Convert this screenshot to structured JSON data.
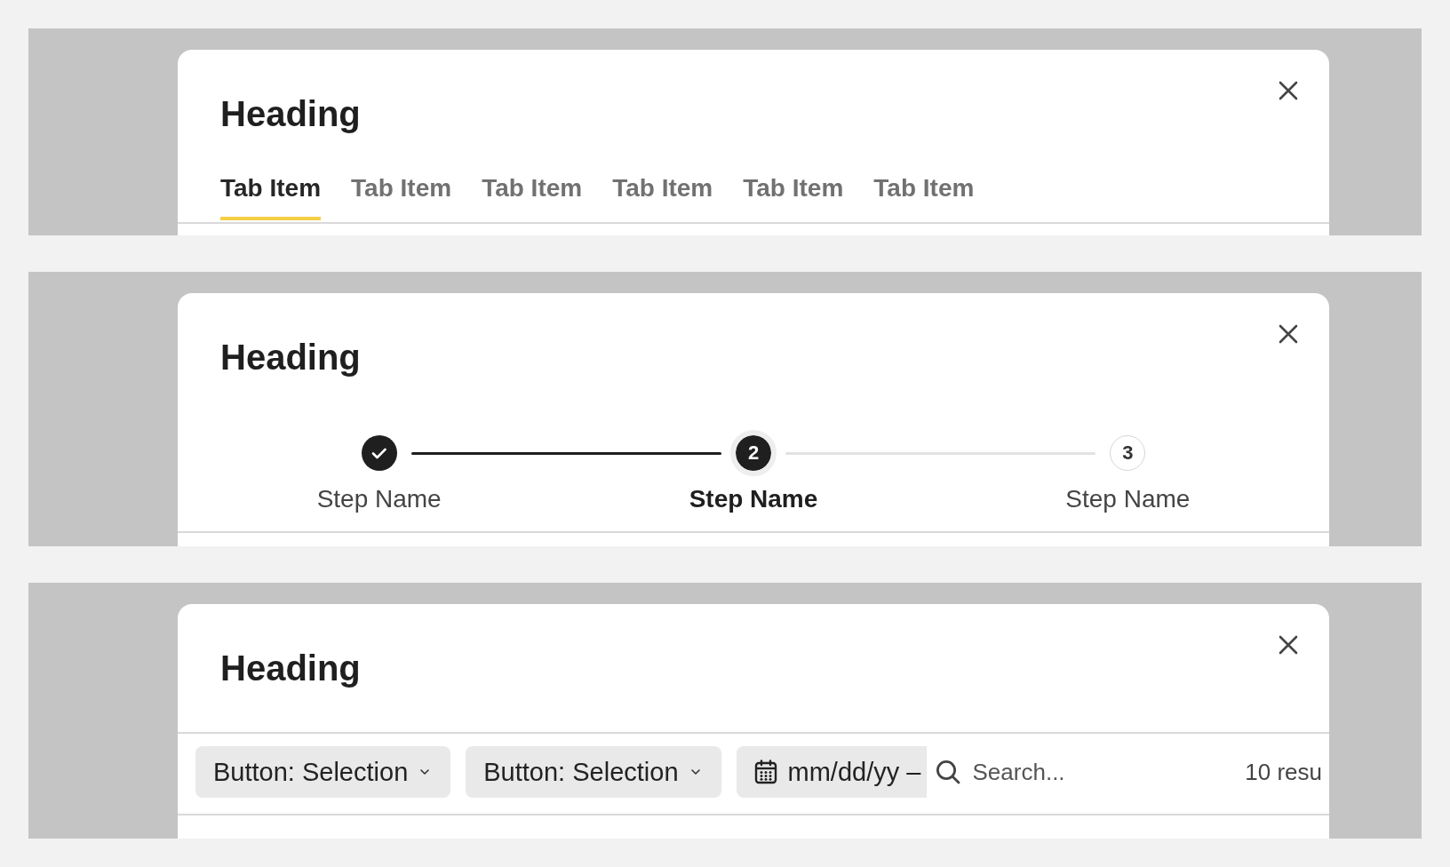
{
  "modals": [
    {
      "kind": "tabs",
      "heading": "Heading",
      "tabs": [
        {
          "label": "Tab Item",
          "selected": true
        },
        {
          "label": "Tab Item",
          "selected": false
        },
        {
          "label": "Tab Item",
          "selected": false
        },
        {
          "label": "Tab Item",
          "selected": false
        },
        {
          "label": "Tab Item",
          "selected": false
        },
        {
          "label": "Tab Item",
          "selected": false
        }
      ]
    },
    {
      "kind": "stepper",
      "heading": "Heading",
      "steps": [
        {
          "label": "Step Name",
          "done": true,
          "current": false
        },
        {
          "label": "Step Name",
          "number": "2",
          "done": false,
          "current": true
        },
        {
          "label": "Step Name",
          "number": "3",
          "done": false,
          "current": false
        }
      ]
    },
    {
      "kind": "toolbar",
      "heading": "Heading",
      "toolbar": {
        "selects": [
          {
            "label": "Button: Selection"
          },
          {
            "label": "Button: Selection"
          }
        ],
        "date_range": {
          "placeholder": "mm/dd/yy –"
        },
        "search": {
          "placeholder": "Search..."
        },
        "result_count": "10 resu"
      }
    }
  ]
}
